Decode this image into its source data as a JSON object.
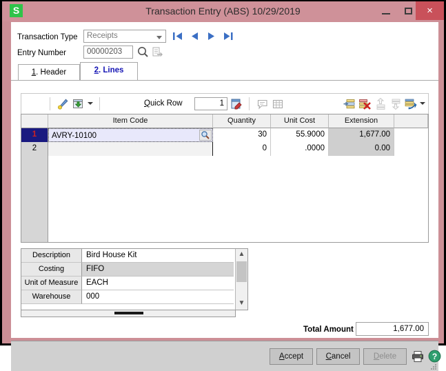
{
  "window": {
    "title": "Transaction Entry (ABS) 10/29/2019",
    "logo_letter": "S",
    "minimize_label": "Minimize",
    "maximize_label": "Maximize",
    "close_label": "×",
    "titlebar_color": "#cf9199",
    "close_color": "#c9515a",
    "logo_color": "#2fc34a"
  },
  "form": {
    "transaction_type_label": "Transaction Type",
    "transaction_type_value": "Receipts",
    "entry_number_label": "Entry Number",
    "entry_number_value": "00000203",
    "nav": {
      "first": "first-record",
      "prev": "previous-record",
      "next": "next-record",
      "last": "last-record"
    }
  },
  "tabs": [
    {
      "num": "1",
      "label": ". Header",
      "active": false
    },
    {
      "num": "2",
      "label": ". Lines",
      "active": true
    }
  ],
  "grid_toolbar": {
    "quick_row_label": "Quick Row",
    "quick_row_value": "1",
    "icons": [
      "pen-icon",
      "window-import-icon",
      "dropdown-caret-icon",
      "quick-row-edit-icon",
      "comment-icon",
      "grid-view-icon",
      "insert-row-icon",
      "delete-row-icon",
      "move-up-icon",
      "move-down-icon",
      "row-options-icon",
      "row-options-caret-icon"
    ]
  },
  "grid": {
    "columns": [
      "",
      "Item Code",
      "Quantity",
      "Unit Cost",
      "Extension",
      ""
    ],
    "rows": [
      {
        "num": "1",
        "item_code": "AVRY-10100",
        "quantity": "30",
        "unit_cost": "55.9000",
        "extension": "1,677.00",
        "selected": true
      },
      {
        "num": "2",
        "item_code": "",
        "quantity": "0",
        "unit_cost": ".0000",
        "extension": "0.00",
        "selected": false
      }
    ]
  },
  "detail": {
    "rows": [
      {
        "label": "Description",
        "value": "Bird House Kit"
      },
      {
        "label": "Costing",
        "value": "FIFO"
      },
      {
        "label": "Unit of Measure",
        "value": "EACH"
      },
      {
        "label": "Warehouse",
        "value": "000"
      }
    ]
  },
  "total": {
    "label": "Total Amount",
    "value": "1,677.00"
  },
  "footer": {
    "accept": {
      "accel": "A",
      "rest": "ccept",
      "disabled": false
    },
    "cancel": {
      "accel": "C",
      "rest": "ancel",
      "disabled": false
    },
    "delete": {
      "accel": "D",
      "rest": "elete",
      "disabled": true
    },
    "print_icon": "print-icon",
    "help_icon": "help-icon"
  }
}
